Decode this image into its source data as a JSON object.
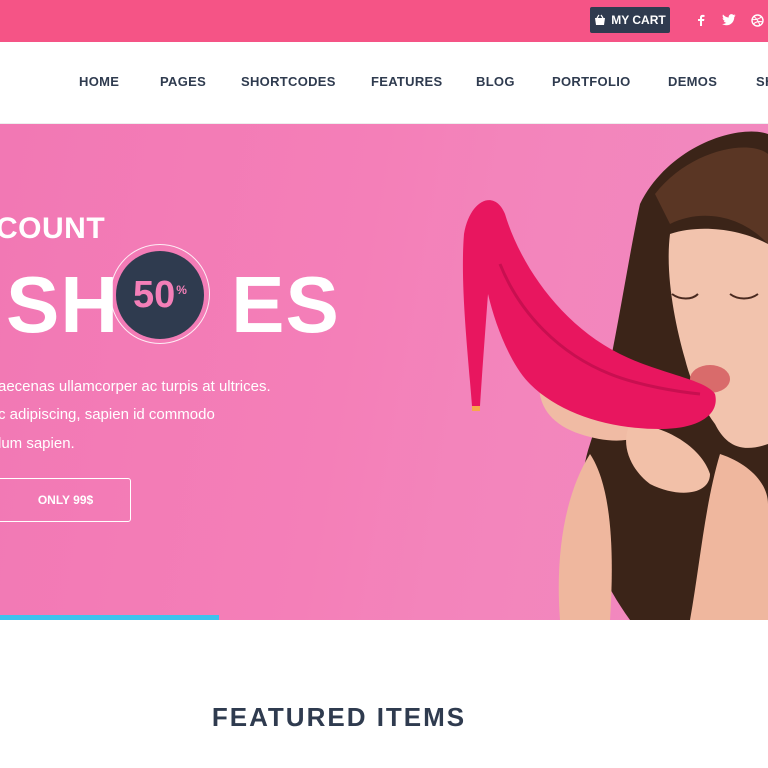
{
  "topbar": {
    "cart_label": "MY CART",
    "social": [
      {
        "icon": "facebook-icon",
        "glyph": "f"
      },
      {
        "icon": "twitter-icon",
        "glyph": "t"
      },
      {
        "icon": "dribbble-icon",
        "glyph": "d"
      }
    ]
  },
  "nav": {
    "items": [
      "HOME",
      "PAGES",
      "SHORTCODES",
      "FEATURES",
      "BLOG",
      "PORTFOLIO",
      "DEMOS",
      "SH"
    ]
  },
  "hero": {
    "subtitle": "COUNT",
    "title_left": "SH",
    "title_right": "ES",
    "badge_value": "50",
    "badge_symbol": "%",
    "text_lines": [
      "aecenas ullamcorper ac turpis at ultrices.",
      "c adipiscing, sapien id commodo",
      "lum sapien."
    ],
    "button_label": "ONLY 99$",
    "slider_progress": 0.285
  },
  "featured": {
    "title": "FEATURED ITEMS"
  },
  "colors": {
    "topbar": "#f55486",
    "dark": "#2f3b4f",
    "hero_pink": "#f47fb8",
    "shoe": "#e8165f",
    "progress": "#3cc3ee"
  }
}
